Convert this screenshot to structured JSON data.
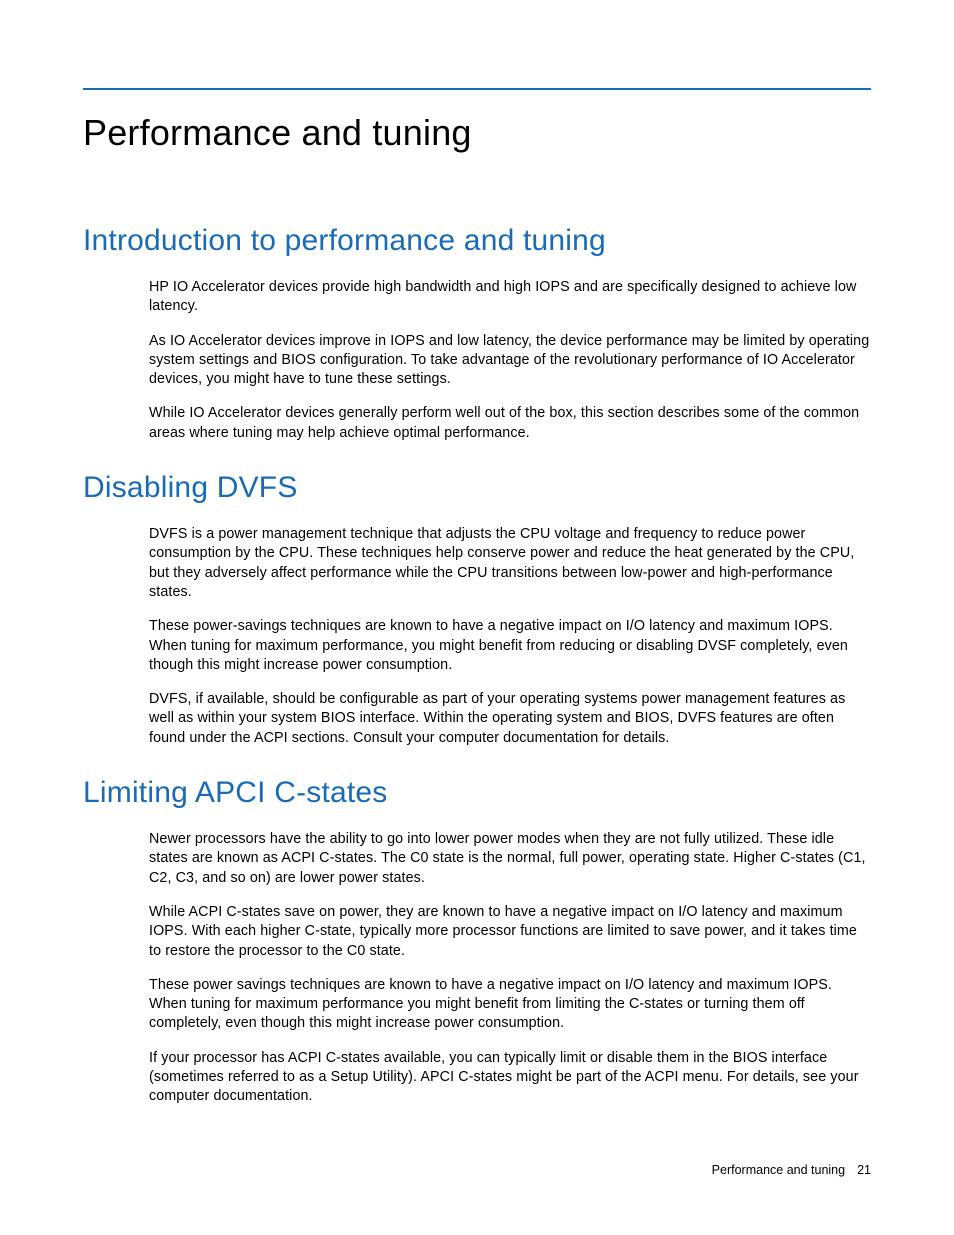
{
  "chapter_title": "Performance and tuning",
  "sections": [
    {
      "heading": "Introduction to performance and tuning",
      "paragraphs": [
        "HP IO Accelerator devices provide high bandwidth and high IOPS and are specifically designed to achieve low latency.",
        "As IO Accelerator devices improve in IOPS and low latency, the device performance may be limited by operating system settings and BIOS configuration. To take advantage of the revolutionary performance of IO Accelerator devices, you might have to tune these settings.",
        "While IO Accelerator devices generally perform well out of the box, this section describes some of the common areas where tuning may help achieve optimal performance."
      ]
    },
    {
      "heading": "Disabling DVFS",
      "paragraphs": [
        "DVFS is a power management technique that adjusts the CPU voltage and frequency to reduce power consumption by the CPU. These techniques help conserve power and reduce the heat generated by the CPU, but they adversely affect performance while the CPU transitions between low-power and high-performance states.",
        "These power-savings techniques are known to have a negative impact on I/O latency and maximum IOPS. When tuning for maximum performance, you might benefit from reducing or disabling DVSF completely, even though this might increase power consumption.",
        "DVFS, if available, should be configurable as part of your operating systems power management features as well as within your system BIOS interface. Within the operating system and BIOS, DVFS features are often found under the ACPI sections. Consult your computer documentation for details."
      ]
    },
    {
      "heading": "Limiting APCI C-states",
      "paragraphs": [
        "Newer processors have the ability to go into lower power modes when they are not fully utilized. These idle states are known as ACPI C-states. The C0 state is the normal, full power, operating state. Higher C-states (C1, C2, C3, and so on) are lower power states.",
        "While ACPI C-states save on power, they are known to have a negative impact on I/O latency and maximum IOPS. With each higher C-state, typically more processor functions are limited to save power, and it takes time to restore the processor to the C0 state.",
        "These power savings techniques are known to have a negative impact on I/O latency and maximum IOPS. When tuning for maximum performance you might benefit from limiting the C-states or turning them off completely, even though this might increase power consumption.",
        "If your processor has ACPI C-states available, you can typically limit or disable them in the BIOS interface (sometimes referred to as a Setup Utility). APCI C-states might be part of the ACPI menu. For details, see your computer documentation."
      ]
    }
  ],
  "footer": {
    "section": "Performance and tuning",
    "page": "21"
  }
}
